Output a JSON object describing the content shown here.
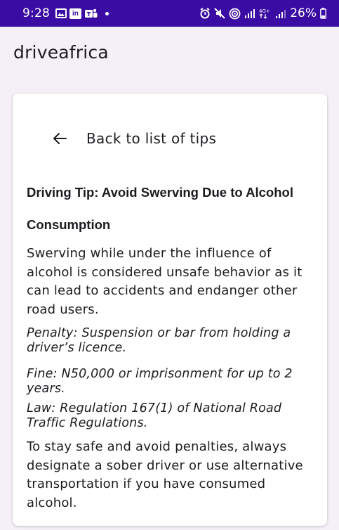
{
  "status_bar": {
    "time": "9:28",
    "battery_percent": "26%",
    "icons": [
      "gallery-icon",
      "linkedin-icon",
      "teams-icon",
      "notification-dot-icon",
      "alarm-icon",
      "mute-icon",
      "hotspot-icon",
      "wifi-signal-icon",
      "4g-signal-icon",
      "signal-icon",
      "battery-icon"
    ],
    "background_color": "#3a0ca3"
  },
  "app": {
    "title": "driveafrica"
  },
  "card": {
    "back_label": "Back to list of tips",
    "tip_title": "Driving Tip: Avoid Swerving Due to Alcohol Consumption",
    "description": "Swerving while under the influence of alcohol is considered unsafe behavior as it can lead to accidents and endanger other road users.",
    "penalty": "Penalty: Suspension or bar from holding a driver’s licence.",
    "fine": "Fine: N50,000 or imprisonment for up to 2 years.",
    "law": "Law: Regulation 167(1) of National Road Traffic Regulations.",
    "advice": "To stay safe and avoid penalties, always designate a sober driver or use alternative transportation if you have consumed alcohol."
  },
  "colors": {
    "page_background": "#f5eff7",
    "card_background": "#ffffff",
    "text": "#1d1b20"
  }
}
